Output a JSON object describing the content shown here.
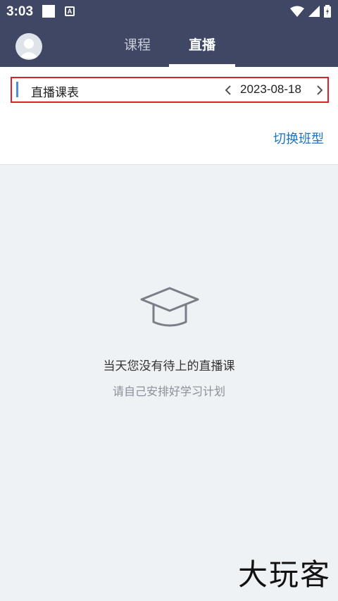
{
  "status_bar": {
    "time": "3:03",
    "notification_badge": "A"
  },
  "header": {
    "tabs": [
      {
        "label": "课程"
      },
      {
        "label": "直播"
      }
    ]
  },
  "schedule": {
    "title": "直播课表",
    "date": "2023-08-18",
    "switch_label": "切换班型"
  },
  "empty_state": {
    "message": "当天您没有待上的直播课",
    "hint": "请自己安排好学习计划"
  },
  "watermark": "大玩客",
  "colors": {
    "header_bg": "#3f4765",
    "accent_blue": "#4a90e2",
    "link_blue": "#1a73c8",
    "highlight_red": "#d9222a",
    "empty_bg": "#eff2f5"
  }
}
